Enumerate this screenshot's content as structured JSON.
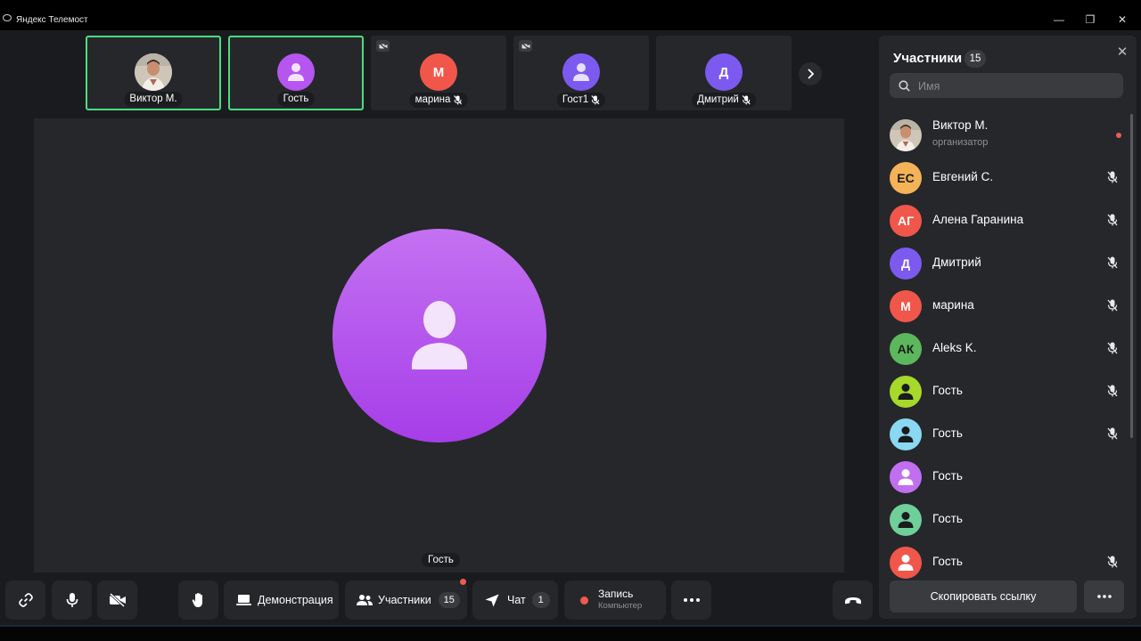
{
  "window": {
    "title": "Яндекс Телемост",
    "minimize": "—",
    "restore": "❐",
    "close": "✕"
  },
  "tiles": [
    {
      "name": "Виктор М.",
      "avatar": "photo",
      "active": true,
      "muted": false
    },
    {
      "name": "Гость",
      "avatar": "guest",
      "color": "#b556ee",
      "active": true,
      "muted": false
    },
    {
      "name": "марина",
      "initial": "М",
      "color": "#f0574a",
      "active": false,
      "muted": true,
      "camera_off": true
    },
    {
      "name": "Гост1",
      "avatar": "guest",
      "color": "#7c5af0",
      "active": false,
      "muted": true,
      "camera_off": true
    },
    {
      "name": "Дмитрий",
      "initial": "Д",
      "color": "#7c5af0",
      "active": false,
      "muted": true
    }
  ],
  "stage": {
    "name": "Гость"
  },
  "toolbar": {
    "demo_label": "Демонстрация",
    "participants_label": "Участники",
    "participants_count": "15",
    "chat_label": "Чат",
    "chat_count": "1",
    "record_label": "Запись",
    "record_sub": "Компьютер"
  },
  "panel": {
    "title": "Участники",
    "count": "15",
    "search_placeholder": "Имя",
    "copy_link": "Скопировать ссылку",
    "participants": [
      {
        "name": "Виктор М.",
        "role": "организатор",
        "avatar": "photo",
        "status": "dot"
      },
      {
        "name": "Евгений С.",
        "initials": "ЕС",
        "color": "#f4b356",
        "text_color": "#1a1b1e",
        "status": "muted"
      },
      {
        "name": "Алена Гаранина",
        "initials": "АГ",
        "color": "#f0574a",
        "text_color": "#ffffff",
        "status": "muted"
      },
      {
        "name": "Дмитрий",
        "initials": "Д",
        "color": "#7c5af0",
        "text_color": "#ffffff",
        "status": "muted"
      },
      {
        "name": "марина",
        "initials": "М",
        "color": "#f0574a",
        "text_color": "#ffffff",
        "status": "muted"
      },
      {
        "name": "Aleks K.",
        "initials": "АК",
        "color": "#5cb85c",
        "text_color": "#1a1b1e",
        "status": "muted"
      },
      {
        "name": "Гость",
        "avatar": "guest",
        "color": "#a6d92a",
        "icon_color": "#1a1b1e",
        "status": "muted"
      },
      {
        "name": "Гость",
        "avatar": "guest",
        "color": "#8ad8f2",
        "icon_color": "#1a1b1e",
        "status": "muted"
      },
      {
        "name": "Гость",
        "avatar": "guest",
        "color": "#c16ef0",
        "icon_color": "#ffffff",
        "status": "none"
      },
      {
        "name": "Гость",
        "avatar": "guest",
        "color": "#6fcf9a",
        "icon_color": "#1a1b1e",
        "status": "none"
      },
      {
        "name": "Гость",
        "avatar": "guest",
        "color": "#f0574a",
        "icon_color": "#ffffff",
        "status": "muted"
      }
    ]
  },
  "colors": {
    "active_border": "#4ade80",
    "notification_dot": "#f05a4f",
    "record_dot": "#f05a4f"
  }
}
